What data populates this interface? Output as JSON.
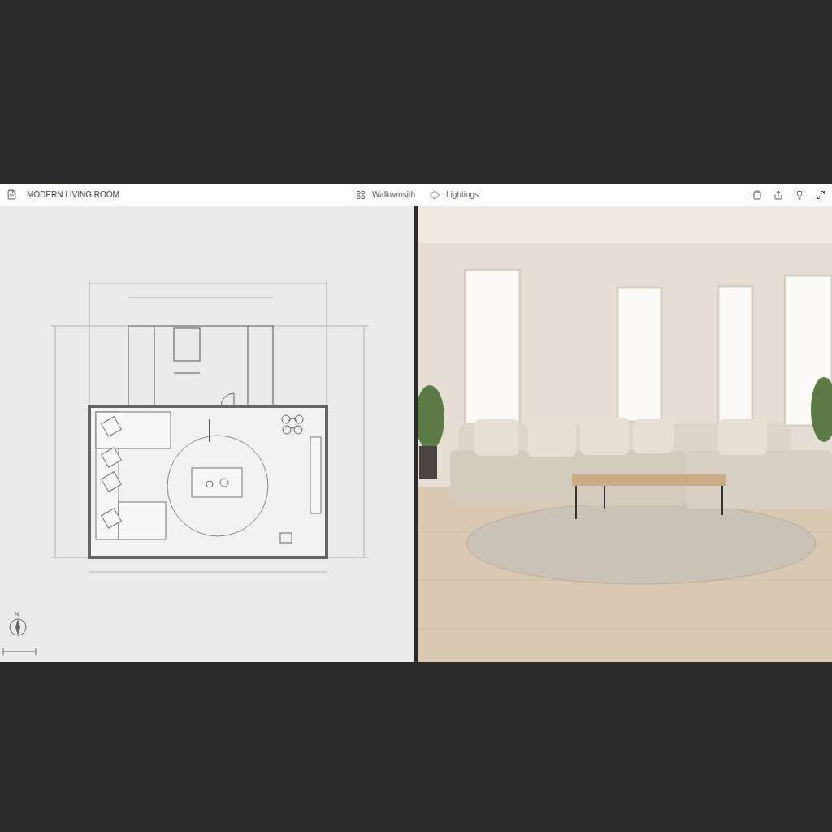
{
  "window": {
    "title": "MODERN LIVING ROOM"
  },
  "toolbar": {
    "items": [
      {
        "label": "Walkwmsith",
        "kind": "layout"
      },
      {
        "label": "Lightings",
        "kind": "light"
      }
    ]
  },
  "plan": {
    "compass": "N"
  }
}
